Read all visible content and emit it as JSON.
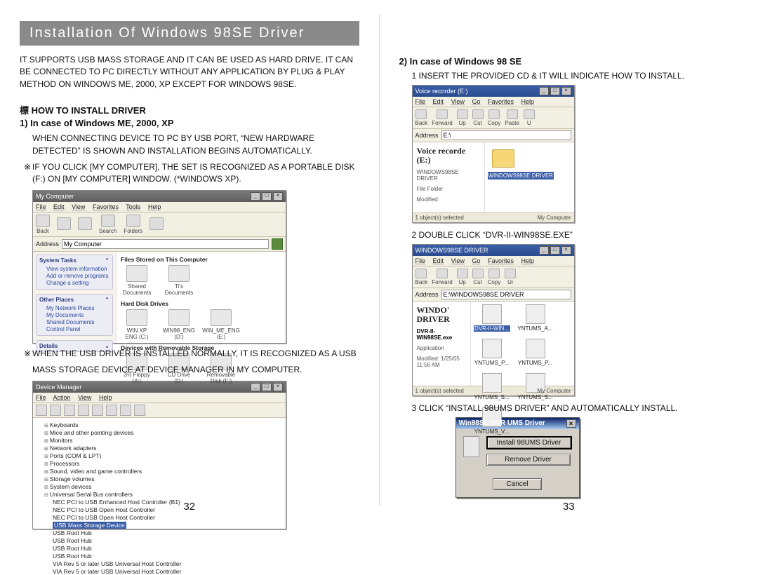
{
  "left": {
    "title": "Installation Of Windows 98SE Driver",
    "intro": "IT SUPPORTS USB MASS STORAGE AND IT CAN BE USED AS HARD DRIVE. IT CAN BE CONNECTED TO PC DIRECTLY WITHOUT ANY APPLICATION BY PLUG & PLAY METHOD ON WINDOWS ME, 2000, XP EXCEPT FOR WINDOWS 98SE.",
    "how_to": "標 HOW TO INSTALL DRIVER",
    "case1_heading": "1) In case of Windows ME, 2000, XP",
    "case1_body": "WHEN CONNECTING DEVICE TO PC BY USB PORT, “NEW HARDWARE DETECTED” IS SHOWN AND INSTALLATION BEGINS AUTOMATICALLY.",
    "case1_note": "IF YOU CLICK [MY COMPUTER], THE SET IS RECOGNIZED AS A PORTABLE DISK (F:) ON [MY COMPUTER] WINDOW. (*WINDOWS XP).",
    "mycomputer": {
      "title": "My Computer",
      "menu": [
        "File",
        "Edit",
        "View",
        "Favorites",
        "Tools",
        "Help"
      ],
      "toolbar": [
        "Back",
        "",
        "",
        "Search",
        "Folders",
        ""
      ],
      "address_label": "Address",
      "address_value": "My Computer",
      "side_sections": {
        "system_tasks": {
          "label": "System Tasks",
          "items": [
            "View system information",
            "Add or remove programs",
            "Change a setting"
          ]
        },
        "other_places": {
          "label": "Other Places",
          "items": [
            "My Network Places",
            "My Documents",
            "Shared Documents",
            "Control Panel"
          ]
        },
        "details": {
          "label": "Details",
          "items": []
        }
      },
      "categories": {
        "files": {
          "label": "Files Stored on This Computer",
          "items": [
            "Shared Documents",
            "Ti's Documents"
          ]
        },
        "hdd": {
          "label": "Hard Disk Drives",
          "items": [
            "WIN XP ENG (C:)",
            "WIN98_ENG (D:)",
            "WIN_ME_ENG (E:)"
          ]
        },
        "removable": {
          "label": "Devices with Removable Storage",
          "items": [
            "3½ Floppy (A:)",
            "CD Drive (D:)",
            "Removable Disk (F:)"
          ]
        }
      }
    },
    "after_mycomputer_note": "WHEN THE USB DRIVER IS INSTALLED NORMALLY, IT IS RECOGNIZED AS A USB",
    "mass_storage_line": "MASS STORAGE DEVICE AT DEVICE MANAGER IN MY COMPUTER.",
    "device_manager": {
      "title": "Device Manager",
      "menu": [
        "File",
        "Action",
        "View",
        "Help"
      ],
      "tree": [
        "Keyboards",
        "Mice and other pointing devices",
        "Monitors",
        "Network adapters",
        "Ports (COM & LPT)",
        "Processors",
        "Sound, video and game controllers",
        "Storage volumes",
        "System devices"
      ],
      "usb_node": "Universal Serial Bus controllers",
      "usb_children": [
        "NEC PCI to USB Enhanced Host Controller (B1)",
        "NEC PCI to USB Open Host Controller",
        "NEC PCI to USB Open Host Controller",
        "USB Mass Storage Device",
        "USB Root Hub",
        "USB Root Hub",
        "USB Root Hub",
        "USB Root Hub",
        "VIA Rev 5 or later USB Universal Host Controller",
        "VIA Rev 5 or later USB Universal Host Controller"
      ],
      "highlight_index": 3
    },
    "page_number": "32"
  },
  "right": {
    "case2_heading": "2) In case of Windows 98 SE",
    "step1": "1 INSERT THE PROVIDED CD & IT WILL INDICATE HOW TO INSTALL.",
    "voice_window": {
      "title": "Voice  recorder (E:)",
      "menu": [
        "File",
        "Edit",
        "View",
        "Go",
        "Favorites",
        "Help"
      ],
      "toolbar": [
        "Back",
        "Forward",
        "Up",
        "Cut",
        "Copy",
        "Paste",
        "U"
      ],
      "address_label": "Address",
      "address_value": "E:\\",
      "side_title": "Voice recorde (E:)",
      "folder_label": "WINDOWS98SE DRIVER",
      "side_sub": "WINDOWS98SE DRIVER",
      "side_type": "File Folder",
      "side_mod": "Modified:",
      "status_left": "1 object(s) selected",
      "status_right": "My Computer"
    },
    "step2": "2 DOUBLE CLICK “DVR-II-WIN98SE.EXE”",
    "driver_window": {
      "title": "WINDOWS98SE DRIVER",
      "menu": [
        "File",
        "Edit",
        "View",
        "Go",
        "Favorites",
        "Help"
      ],
      "toolbar": [
        "Back",
        "Forward",
        "Up",
        "Cut",
        "Copy",
        "Ur"
      ],
      "address_label": "Address",
      "address_value": "E:\\WINDOWS98SE DRIVER",
      "side_title": "WINDO' DRIVER",
      "side_file": "DVR-II-WIN98SE.exe",
      "side_type": "Application",
      "side_mod": "Modified: 1/25/05 11:56 AM",
      "files": [
        "DVR-II-WIN...",
        "YNTUMS_A...",
        "YNTUMS_P...",
        "YNTUMS_P...",
        "YNTUMS_S...",
        "YNTUMS_S...",
        "YNTUMS_V..."
      ],
      "selected_index": 0,
      "status_left": "1 object(s) selected",
      "status_right": "My Computer"
    },
    "step3": "3 CLICK “INSTALL 98UMS DRIVER” AND AUTOMATICALLY INSTALL.",
    "dialog": {
      "title": "Win98SE DVR UMS Driver",
      "btn_install": "Install 98UMS Driver",
      "btn_remove": "Remove Driver",
      "btn_cancel": "Cancel"
    },
    "page_number": "33"
  }
}
